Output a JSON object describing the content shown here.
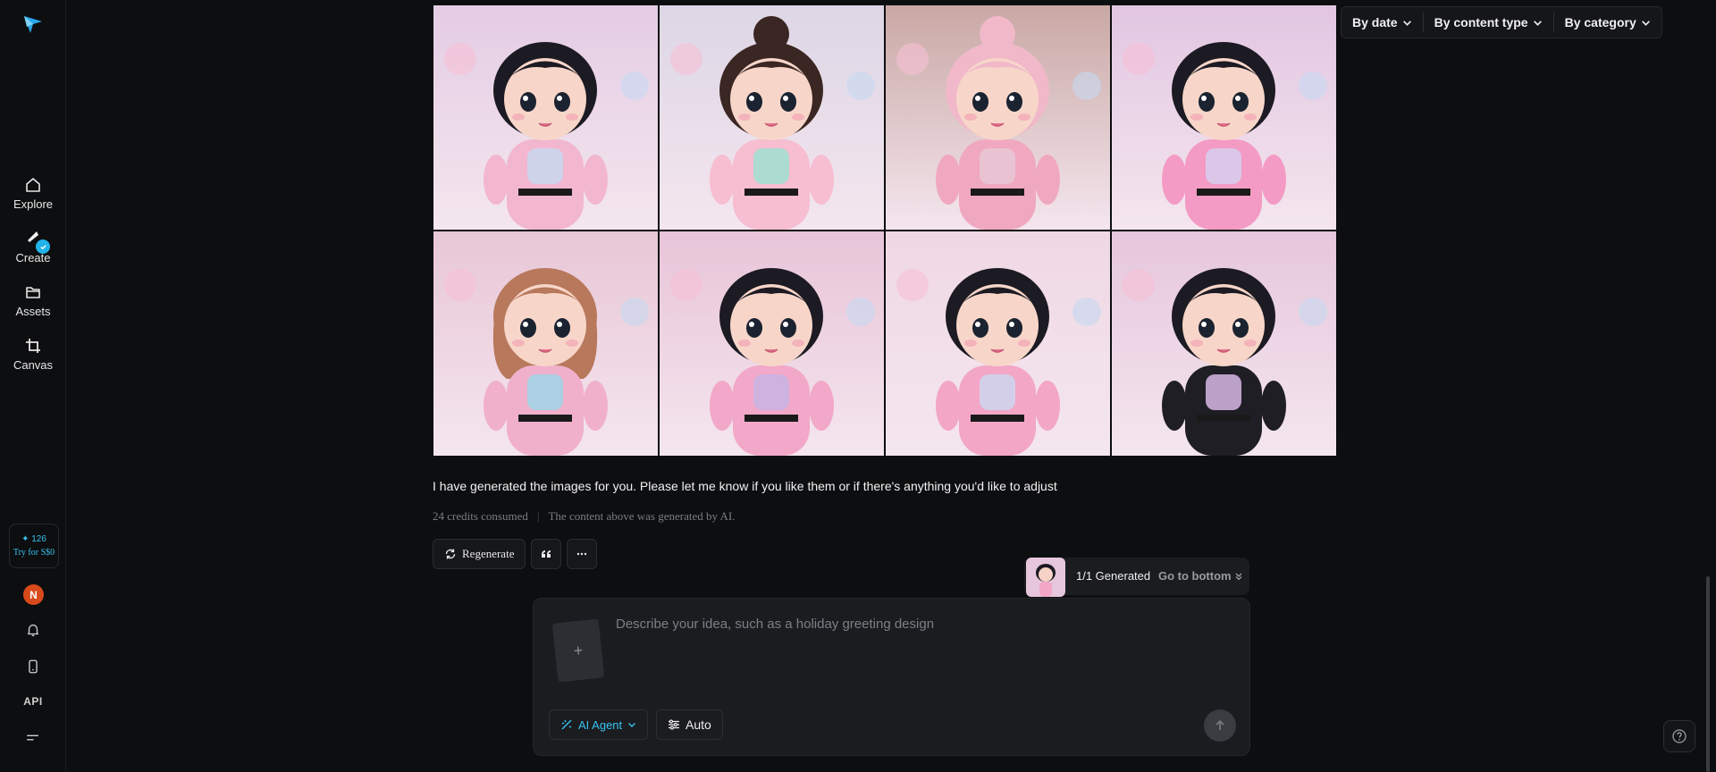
{
  "sidebar": {
    "nav": [
      {
        "label": "Explore",
        "icon": "home-icon"
      },
      {
        "label": "Create",
        "icon": "create-icon"
      },
      {
        "label": "Assets",
        "icon": "folder-icon"
      },
      {
        "label": "Canvas",
        "icon": "canvas-icon"
      }
    ],
    "credits": {
      "count": "126",
      "cta": "Try for S$0"
    },
    "avatar_initial": "N",
    "api_label": "API"
  },
  "filters": {
    "date": "By date",
    "content_type": "By content type",
    "category": "By category"
  },
  "message": {
    "text": "I have generated the images for you. Please let me know if you like them or if there's anything you'd like to adjust",
    "credits": "24 credits consumed",
    "separator": "|",
    "disclaimer": "The content above was generated by AI."
  },
  "actions": {
    "regenerate": "Regenerate"
  },
  "generated": {
    "status": "1/1 Generated",
    "go_bottom": "Go to bottom"
  },
  "composer": {
    "placeholder": "Describe your idea, such as a holiday greeting design",
    "agent_label": "AI Agent",
    "mode_label": "Auto"
  },
  "images": [
    {
      "hair": "#1c1a22",
      "outfit": "#f2b6cf",
      "accent": "#c9d8ee",
      "bg": "#e4cce4",
      "hairstyle": "short"
    },
    {
      "hair": "#3a2622",
      "outfit": "#f7bdd0",
      "accent": "#9fe0d2",
      "bg": "#ddd6e6",
      "hairstyle": "bun"
    },
    {
      "hair": "#f0b8c8",
      "outfit": "#f0a8c0",
      "accent": "#e8c8d4",
      "bg": "#c9a8a4",
      "hairstyle": "bun"
    },
    {
      "hair": "#1c1a22",
      "outfit": "#f39bc4",
      "accent": "#d6d0ee",
      "bg": "#e2c6e2",
      "hairstyle": "short"
    },
    {
      "hair": "#b8785c",
      "outfit": "#f0b0cc",
      "accent": "#9fd6e6",
      "bg": "#e8c6d6",
      "hairstyle": "long"
    },
    {
      "hair": "#1c1a22",
      "outfit": "#f2a8c8",
      "accent": "#c8b4e4",
      "bg": "#e8c4d8",
      "hairstyle": "short"
    },
    {
      "hair": "#1c1a22",
      "outfit": "#f3a6c6",
      "accent": "#cdd6ee",
      "bg": "#efd8e4",
      "hairstyle": "short"
    },
    {
      "hair": "#1c1a22",
      "outfit": "#1e1e24",
      "accent": "#d8b8e6",
      "bg": "#e6c6dc",
      "hairstyle": "short"
    }
  ]
}
